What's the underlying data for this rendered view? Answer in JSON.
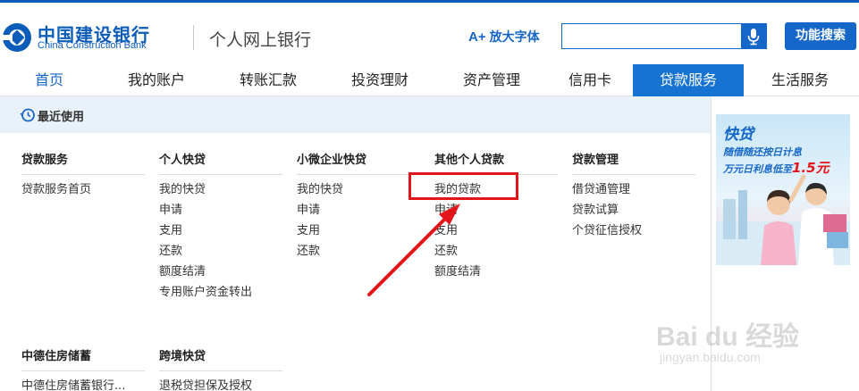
{
  "header": {
    "logo_cn": "中国建设银行",
    "logo_en": "China Construction Bank",
    "subtitle": "个人网上银行",
    "enlarge_font_label": "放大字体",
    "enlarge_font_icon": "A+",
    "search_placeholder": "",
    "search_button_label": "功能搜索",
    "brand_color": "#1466c8"
  },
  "nav": {
    "items": [
      {
        "label": "首页"
      },
      {
        "label": "我的账户"
      },
      {
        "label": "转账汇款"
      },
      {
        "label": "投资理财"
      },
      {
        "label": "资产管理"
      },
      {
        "label": "信用卡"
      },
      {
        "label": "贷款服务"
      },
      {
        "label": "生活服务"
      }
    ],
    "active_index": 6
  },
  "recent": {
    "label": "最近使用"
  },
  "menu": {
    "columns": [
      {
        "title": "贷款服务",
        "links": [
          "贷款服务首页"
        ]
      },
      {
        "title": "个人快贷",
        "links": [
          "我的快贷",
          "申请",
          "支用",
          "还款",
          "额度结清",
          "专用账户资金转出"
        ]
      },
      {
        "title": "小微企业快贷",
        "links": [
          "我的快贷",
          "申请",
          "支用",
          "还款"
        ]
      },
      {
        "title": "其他个人贷款",
        "links": [
          "我的贷款",
          "申请",
          "支用",
          "还款",
          "额度结清"
        ]
      },
      {
        "title": "贷款管理",
        "links": [
          "借贷通管理",
          "贷款试算",
          "个贷征信授权"
        ]
      },
      {
        "title": "中德住房储蓄",
        "links": [
          "中德住房储蓄银行..."
        ]
      },
      {
        "title": "跨境快贷",
        "links": [
          "退税贷担保及授权"
        ]
      }
    ]
  },
  "ad": {
    "title": "快贷",
    "line1": "随借随还按日计息",
    "line2_prefix": "万元日利息低至",
    "line2_rate": "1.5元"
  },
  "watermark": {
    "main": "Bai du 经验",
    "sub": "jingyan.baidu.com"
  },
  "annotation": {
    "highlight_color": "#e4141b"
  }
}
